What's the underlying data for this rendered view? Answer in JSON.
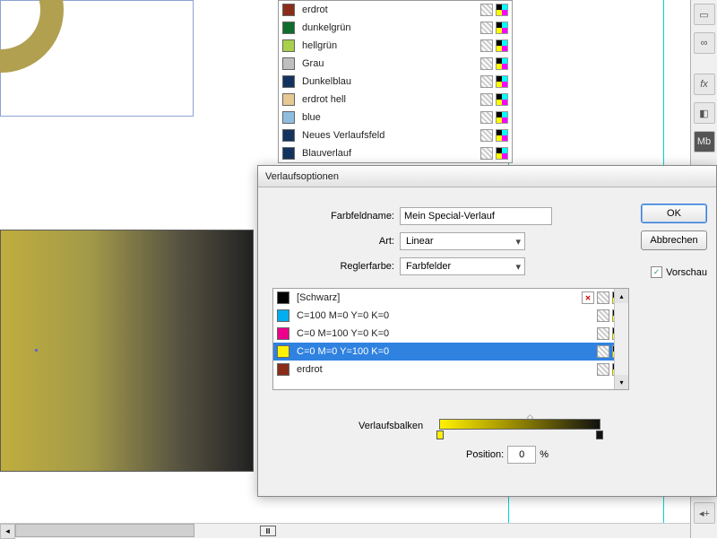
{
  "swatches": [
    {
      "color": "#8a2c1a",
      "label": "erdrot"
    },
    {
      "color": "#0e6d2c",
      "label": "dunkelgrün"
    },
    {
      "color": "#a8d04a",
      "label": "hellgrün"
    },
    {
      "color": "#bfbfbf",
      "label": "Grau"
    },
    {
      "color": "#12335e",
      "label": "Dunkelblau"
    },
    {
      "color": "#e6c893",
      "label": "erdrot hell"
    },
    {
      "color": "#8fbde0",
      "label": "blue"
    },
    {
      "color": "#12335e",
      "label": "Neues Verlaufsfeld"
    },
    {
      "color": "#12335e",
      "label": "Blauverlauf"
    }
  ],
  "dialog": {
    "title": "Verlaufsoptionen",
    "fieldname_label": "Farbfeldname:",
    "fieldname_value": "Mein Special-Verlauf",
    "type_label": "Art:",
    "type_value": "Linear",
    "stopcolor_label": "Reglerfarbe:",
    "stopcolor_value": "Farbfelder",
    "ok": "OK",
    "cancel": "Abbrechen",
    "preview": "Vorschau",
    "ramp_label": "Verlaufsbalken",
    "position_label": "Position:",
    "position_value": "0",
    "position_unit": "%"
  },
  "stoplist": [
    {
      "color": "#000000",
      "label": "[Schwarz]",
      "locked": true
    },
    {
      "color": "#00aeef",
      "label": "C=100 M=0 Y=0 K=0"
    },
    {
      "color": "#ec008c",
      "label": "C=0 M=100 Y=0 K=0"
    },
    {
      "color": "#fff200",
      "label": "C=0 M=0 Y=100 K=0",
      "selected": true
    },
    {
      "color": "#8a2c1a",
      "label": "erdrot"
    }
  ]
}
